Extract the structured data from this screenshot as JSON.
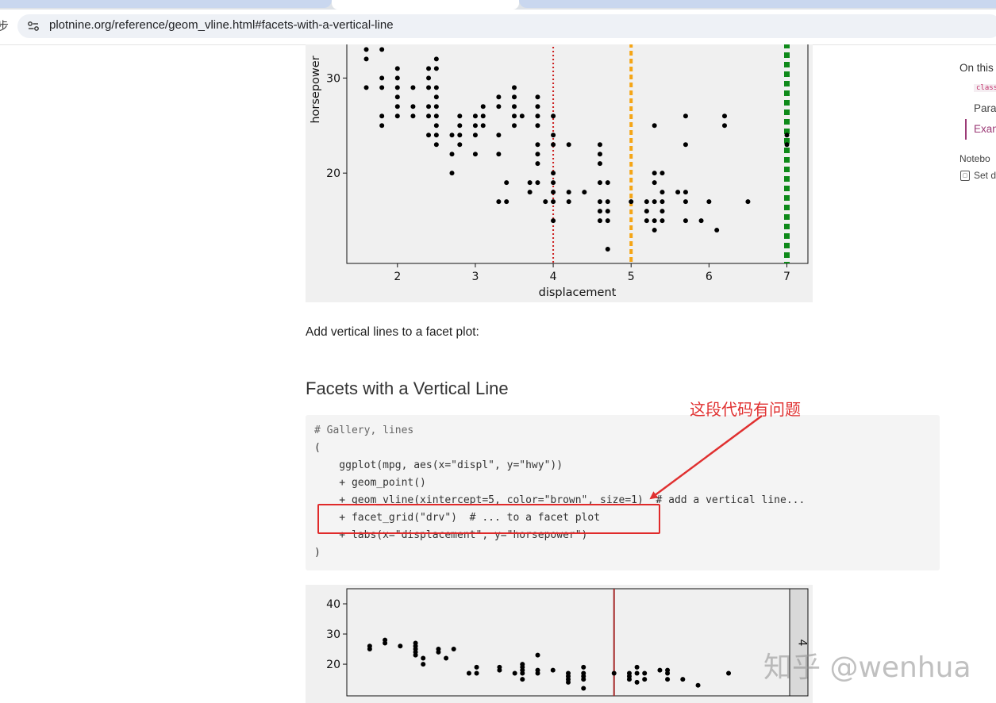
{
  "browser": {
    "url": "plotnine.org/reference/geom_vline.html#facets-with-a-vertical-line",
    "back_glyph": "步"
  },
  "toc": {
    "title": "On this",
    "code_item": "class",
    "items": [
      "Para",
      "Exan"
    ],
    "notebook_label": "Notebo",
    "set_label": "Set d"
  },
  "content": {
    "paragraph": "Add vertical lines to a facet plot:",
    "section_heading": "Facets with a Vertical Line",
    "code_lines": [
      "# Gallery, lines",
      "(",
      "    ggplot(mpg, aes(x=\"displ\", y=\"hwy\"))",
      "    + geom_point()",
      "    + geom_vline(xintercept=5, color=\"brown\", size=1)  # add a vertical line...",
      "    + facet_grid(\"drv\")  # ... to a facet plot",
      "    + labs(x=\"displacement\", y=\"horsepower\")",
      ")"
    ],
    "annotation": "这段代码有问题",
    "watermark": "知乎 @wenhua"
  },
  "colors": {
    "panel_bg": "#f0f0f0",
    "vline_red": "#cc1f1f",
    "vline_orange": "#f5a516",
    "vline_green": "#0f8a1a",
    "vline_brown": "#a52a2a",
    "annotation_red": "#e03030"
  },
  "chart_data": [
    {
      "type": "scatter",
      "xlabel": "displacement",
      "ylabel": "horsepower",
      "xlim": [
        1.35,
        7.27
      ],
      "ylim": [
        10.5,
        33.7
      ],
      "xticks": [
        2,
        3,
        4,
        5,
        6,
        7
      ],
      "yticks": [
        20,
        30
      ],
      "vlines": [
        {
          "x": 4,
          "color": "#cc1f1f",
          "style": "dotted"
        },
        {
          "x": 5,
          "color": "#f5a516",
          "style": "dashed"
        },
        {
          "x": 7,
          "color": "#0f8a1a",
          "style": "dashed-thick"
        }
      ],
      "points": [
        [
          1.6,
          33
        ],
        [
          1.6,
          32
        ],
        [
          1.6,
          29
        ],
        [
          1.8,
          33
        ],
        [
          1.8,
          30
        ],
        [
          1.8,
          29
        ],
        [
          1.8,
          26
        ],
        [
          1.8,
          25
        ],
        [
          2.0,
          31
        ],
        [
          2.0,
          30
        ],
        [
          2.0,
          29
        ],
        [
          2.0,
          28
        ],
        [
          2.0,
          27
        ],
        [
          2.0,
          26
        ],
        [
          2.2,
          29
        ],
        [
          2.2,
          27
        ],
        [
          2.2,
          26
        ],
        [
          2.4,
          31
        ],
        [
          2.4,
          30
        ],
        [
          2.4,
          29
        ],
        [
          2.4,
          27
        ],
        [
          2.4,
          26
        ],
        [
          2.4,
          24
        ],
        [
          2.5,
          32
        ],
        [
          2.5,
          31
        ],
        [
          2.5,
          29
        ],
        [
          2.5,
          28
        ],
        [
          2.5,
          27
        ],
        [
          2.5,
          26
        ],
        [
          2.5,
          25
        ],
        [
          2.5,
          24
        ],
        [
          2.5,
          23
        ],
        [
          2.7,
          24
        ],
        [
          2.7,
          22
        ],
        [
          2.7,
          20
        ],
        [
          2.8,
          26
        ],
        [
          2.8,
          25
        ],
        [
          2.8,
          24
        ],
        [
          2.8,
          23
        ],
        [
          3.0,
          26
        ],
        [
          3.0,
          25
        ],
        [
          3.0,
          24
        ],
        [
          3.0,
          22
        ],
        [
          3.1,
          27
        ],
        [
          3.1,
          26
        ],
        [
          3.1,
          25
        ],
        [
          3.3,
          28
        ],
        [
          3.3,
          27
        ],
        [
          3.3,
          24
        ],
        [
          3.3,
          22
        ],
        [
          3.3,
          17
        ],
        [
          3.4,
          19
        ],
        [
          3.4,
          17
        ],
        [
          3.5,
          29
        ],
        [
          3.5,
          28
        ],
        [
          3.5,
          27
        ],
        [
          3.5,
          26
        ],
        [
          3.5,
          25
        ],
        [
          3.6,
          26
        ],
        [
          3.7,
          19
        ],
        [
          3.7,
          18
        ],
        [
          3.8,
          28
        ],
        [
          3.8,
          27
        ],
        [
          3.8,
          26
        ],
        [
          3.8,
          25
        ],
        [
          3.8,
          23
        ],
        [
          3.8,
          22
        ],
        [
          3.8,
          21
        ],
        [
          3.8,
          19
        ],
        [
          3.9,
          17
        ],
        [
          4.0,
          26
        ],
        [
          4.0,
          24
        ],
        [
          4.0,
          23
        ],
        [
          4.0,
          20
        ],
        [
          4.0,
          19
        ],
        [
          4.0,
          18
        ],
        [
          4.0,
          17
        ],
        [
          4.0,
          15
        ],
        [
          4.2,
          23
        ],
        [
          4.2,
          18
        ],
        [
          4.2,
          17
        ],
        [
          4.4,
          18
        ],
        [
          4.6,
          23
        ],
        [
          4.6,
          22
        ],
        [
          4.6,
          21
        ],
        [
          4.6,
          19
        ],
        [
          4.6,
          17
        ],
        [
          4.6,
          16
        ],
        [
          4.6,
          15
        ],
        [
          4.7,
          19
        ],
        [
          4.7,
          17
        ],
        [
          4.7,
          16
        ],
        [
          4.7,
          15
        ],
        [
          4.7,
          12
        ],
        [
          5.0,
          17
        ],
        [
          5.2,
          17
        ],
        [
          5.2,
          16
        ],
        [
          5.2,
          15
        ],
        [
          5.3,
          25
        ],
        [
          5.3,
          20
        ],
        [
          5.3,
          19
        ],
        [
          5.3,
          17
        ],
        [
          5.3,
          15
        ],
        [
          5.3,
          14
        ],
        [
          5.4,
          20
        ],
        [
          5.4,
          18
        ],
        [
          5.4,
          17
        ],
        [
          5.4,
          16
        ],
        [
          5.4,
          15
        ],
        [
          5.6,
          18
        ],
        [
          5.7,
          26
        ],
        [
          5.7,
          23
        ],
        [
          5.7,
          18
        ],
        [
          5.7,
          17
        ],
        [
          5.7,
          15
        ],
        [
          5.9,
          15
        ],
        [
          6.0,
          17
        ],
        [
          6.1,
          14
        ],
        [
          6.2,
          26
        ],
        [
          6.2,
          25
        ],
        [
          6.5,
          17
        ],
        [
          7.0,
          24
        ],
        [
          7.0,
          23
        ]
      ]
    },
    {
      "type": "scatter",
      "facet_strip": "4",
      "xlim": [
        1.5,
        7.3
      ],
      "ylim": [
        9.5,
        45
      ],
      "yticks": [
        20,
        30,
        40
      ],
      "vlines": [
        {
          "x": 5,
          "color": "#a52a2a",
          "style": "solid"
        }
      ],
      "points": [
        [
          1.8,
          26
        ],
        [
          1.8,
          25
        ],
        [
          2.0,
          28
        ],
        [
          2.0,
          27
        ],
        [
          2.2,
          26
        ],
        [
          2.4,
          27
        ],
        [
          2.4,
          26
        ],
        [
          2.4,
          25
        ],
        [
          2.4,
          24
        ],
        [
          2.4,
          23
        ],
        [
          2.5,
          22
        ],
        [
          2.5,
          20
        ],
        [
          2.7,
          25
        ],
        [
          2.7,
          24
        ],
        [
          2.8,
          22
        ],
        [
          2.9,
          25
        ],
        [
          3.1,
          17
        ],
        [
          3.2,
          19
        ],
        [
          3.2,
          17
        ],
        [
          3.5,
          19
        ],
        [
          3.5,
          18
        ],
        [
          3.7,
          17
        ],
        [
          3.8,
          20
        ],
        [
          3.8,
          19
        ],
        [
          3.8,
          18
        ],
        [
          3.8,
          17
        ],
        [
          3.8,
          15
        ],
        [
          4.0,
          23
        ],
        [
          4.0,
          18
        ],
        [
          4.0,
          17
        ],
        [
          4.2,
          18
        ],
        [
          4.4,
          17
        ],
        [
          4.4,
          16
        ],
        [
          4.4,
          15
        ],
        [
          4.4,
          14
        ],
        [
          4.6,
          19
        ],
        [
          4.6,
          17
        ],
        [
          4.6,
          16
        ],
        [
          4.6,
          15
        ],
        [
          4.6,
          12
        ],
        [
          5.0,
          17
        ],
        [
          5.2,
          17
        ],
        [
          5.2,
          16
        ],
        [
          5.2,
          15
        ],
        [
          5.3,
          19
        ],
        [
          5.3,
          17
        ],
        [
          5.3,
          14
        ],
        [
          5.4,
          17
        ],
        [
          5.4,
          15
        ],
        [
          5.6,
          18
        ],
        [
          5.7,
          18
        ],
        [
          5.7,
          17
        ],
        [
          5.7,
          15
        ],
        [
          5.9,
          15
        ],
        [
          6.1,
          13
        ],
        [
          6.5,
          17
        ]
      ]
    }
  ]
}
